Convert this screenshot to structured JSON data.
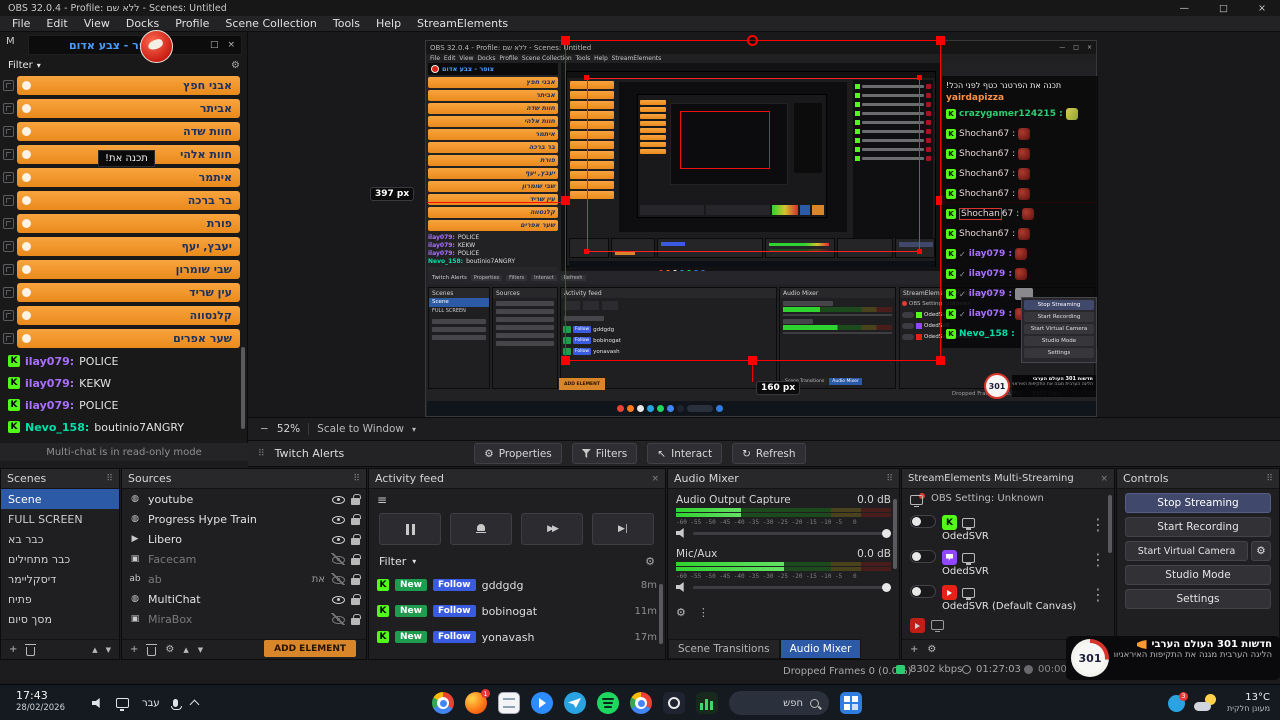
{
  "colors": {
    "accent_blue": "#2d5aa7",
    "kick_green": "#53fc18",
    "add_orange": "#d9862a",
    "selection_red": "#ff0000",
    "purple": "#a970ff",
    "chat_green": "#00e0a8"
  },
  "glyphs": {
    "minimize": "—",
    "maximize": "□",
    "close": "×",
    "caret": "▾",
    "gear": "⚙",
    "dots": "⋮",
    "grip": "⠿",
    "hamburger": "≡",
    "plus": "+",
    "check": "✓",
    "up": "▲",
    "down": "▼",
    "play": "▶",
    "minus": "−",
    "interact": "↖",
    "refresh": "↻",
    "kick": "K",
    "ffwd": "▶▶",
    "skip": "▶|",
    "popout": "□",
    "text_source": "ab"
  },
  "titlebar": {
    "title": "OBS 32.0.4 - Profile: ללא שם - Scenes: Untitled"
  },
  "menubar": {
    "items": [
      "File",
      "Edit",
      "View",
      "Docks",
      "Profile",
      "Scene Collection",
      "Tools",
      "Help",
      "StreamElements"
    ],
    "joined": "File  Edit  View  Docks  Profile  Scene Collection  Tools  Help  StreamElements"
  },
  "multichat": {
    "dock_partial": "M",
    "popup_title": "צופר - צבע אדום",
    "filter": "Filter",
    "channels": [
      "אבני חפץ",
      "אביתר",
      "חוות שדה",
      "חוות אלהי",
      "איתמר",
      "בר ברכה",
      "פורת",
      "יעבץ, יעף",
      "שבי שומרון",
      "עין שריד",
      "קלנסווה",
      "שער אפרים"
    ],
    "tooltip": "תכנה את!",
    "messages": [
      {
        "user": "ilay079:",
        "text": "POLICE"
      },
      {
        "user": "ilay079:",
        "text": "KEKW"
      },
      {
        "user": "ilay079:",
        "text": "POLICE"
      },
      {
        "user": "Nevo_158:",
        "text": "boutinio7ANGRY"
      }
    ],
    "footer": "Multi-chat is in read-only mode"
  },
  "preview": {
    "zoom": "52%",
    "scale_mode": "Scale to Window",
    "width_label": "397 px",
    "height_label": "160 px"
  },
  "overlay_chat": {
    "line1": "תכנה את הפרטנר כטף לפני הכל!",
    "line1_user": "yairdapizza",
    "rows": [
      "crazygamer124215 :",
      "Shochan67 :",
      "Shochan67 :",
      "Shochan67 :",
      "Shochan67 :",
      "Shochan67 :",
      "ilay079 :",
      "ilay079 :",
      "ilay079 :",
      "ilay079 :",
      "Nevo_158 :"
    ],
    "highlight_a": "Shochan",
    "highlight_b": "67 :"
  },
  "alerts_dock": {
    "title": "Twitch Alerts",
    "buttons": [
      "Properties",
      "Filters",
      "Interact",
      "Refresh"
    ]
  },
  "scenes": {
    "title": "Scenes",
    "selected": "Scene",
    "items": [
      "Scene",
      "FULL SCREEN",
      "כבר בא",
      "כבר מתחילים",
      "דיסקליימר",
      "פתיח",
      "מסך סיום"
    ]
  },
  "sources": {
    "title": "Sources",
    "add_element": "ADD ELEMENT",
    "items": [
      {
        "name": "youtube",
        "visible": true
      },
      {
        "name": "Progress Hype Train",
        "visible": true
      },
      {
        "name": "Libero",
        "visible": true
      },
      {
        "name": "Facecam",
        "visible": false
      },
      {
        "name": "ab",
        "right_text": "את",
        "visible": false
      },
      {
        "name": "MultiChat",
        "visible": true
      },
      {
        "name": "MiraBox",
        "visible": false
      }
    ]
  },
  "activity": {
    "title": "Activity feed",
    "filter": "Filter",
    "badge_new": "New",
    "badge_follow": "Follow",
    "events": [
      {
        "name": "gddgdg",
        "time": "8m"
      },
      {
        "name": "bobinogat",
        "time": "11m"
      },
      {
        "name": "yonavash",
        "time": "17m"
      }
    ]
  },
  "audio": {
    "title": "Audio Mixer",
    "ticks": "-60 -55 -50 -45 -40 -35 -30 -25 -20 -15 -10 -5   0",
    "channels": [
      {
        "name": "Audio Output Capture",
        "db": "0.0 dB"
      },
      {
        "name": "Mic/Aux",
        "db": "0.0 dB"
      }
    ],
    "tabs": [
      "Scene Transitions",
      "Audio Mixer"
    ]
  },
  "multistream": {
    "title": "StreamElements Multi-Streaming",
    "obs_setting": "OBS Setting: Unknown",
    "destinations": [
      {
        "name": "OdedSVR",
        "platform": "kick"
      },
      {
        "name": "OdedSVR",
        "platform": "twitch"
      },
      {
        "name": "OdedSVR (Default Canvas)",
        "platform": "youtube"
      }
    ]
  },
  "controls": {
    "title": "Controls",
    "buttons": [
      "Stop Streaming",
      "Start Recording",
      "Start Virtual Camera",
      "Studio Mode",
      "Settings"
    ]
  },
  "statusbar": {
    "dropped": "Dropped Frames 0 (0.0%)",
    "bitrate": "8302 kbps",
    "time": "01:27:03",
    "rec": "00:00:0"
  },
  "news": {
    "logo": "301",
    "title": "חדשות 301 העולם הערבי",
    "body": "הליגה הערבית מגנה את התקיפות האיראניות נגד קטאר: בחריין, כווית..."
  },
  "taskbar": {
    "time": "17:43",
    "date": "28/02/2026",
    "lang": "עבר",
    "search": "חפש",
    "badge": "3",
    "temp": "13°C",
    "desc": "מעונן חלקית"
  }
}
